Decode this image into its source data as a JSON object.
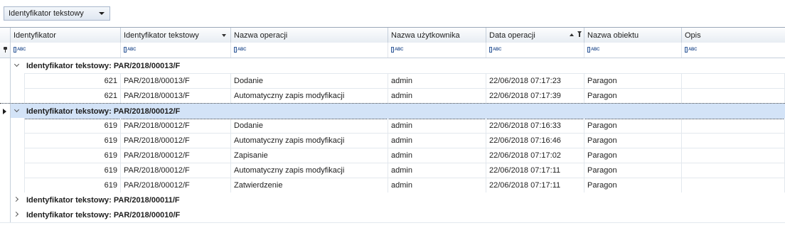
{
  "group_panel": {
    "label": "Identyfikator tekstowy"
  },
  "columns": [
    {
      "label": "Identyfikator"
    },
    {
      "label": "Identyfikator tekstowy"
    },
    {
      "label": "Nazwa operacji"
    },
    {
      "label": "Nazwa użytkownika"
    },
    {
      "label": "Data operacji"
    },
    {
      "label": "Nazwa obiektu"
    },
    {
      "label": "Opis"
    }
  ],
  "filter_icon_text": "ABC",
  "groups": [
    {
      "label": "Identyfikator tekstowy: PAR/2018/00013/F",
      "expanded": true,
      "rows": [
        {
          "id": "621",
          "text_id": "PAR/2018/00013/F",
          "operation": "Dodanie",
          "user": "admin",
          "date": "22/06/2018 07:17:23",
          "object": "Paragon",
          "desc": ""
        },
        {
          "id": "621",
          "text_id": "PAR/2018/00013/F",
          "operation": "Automatyczny zapis modyfikacji",
          "user": "admin",
          "date": "22/06/2018 07:17:39",
          "object": "Paragon",
          "desc": ""
        }
      ]
    },
    {
      "label": "Identyfikator tekstowy: PAR/2018/00012/F",
      "expanded": true,
      "selected": true,
      "rows": [
        {
          "id": "619",
          "text_id": "PAR/2018/00012/F",
          "operation": "Dodanie",
          "user": "admin",
          "date": "22/06/2018 07:16:33",
          "object": "Paragon",
          "desc": ""
        },
        {
          "id": "619",
          "text_id": "PAR/2018/00012/F",
          "operation": "Automatyczny zapis modyfikacji",
          "user": "admin",
          "date": "22/06/2018 07:16:46",
          "object": "Paragon",
          "desc": ""
        },
        {
          "id": "619",
          "text_id": "PAR/2018/00012/F",
          "operation": "Zapisanie",
          "user": "admin",
          "date": "22/06/2018 07:17:02",
          "object": "Paragon",
          "desc": ""
        },
        {
          "id": "619",
          "text_id": "PAR/2018/00012/F",
          "operation": "Automatyczny zapis modyfikacji",
          "user": "admin",
          "date": "22/06/2018 07:17:11",
          "object": "Paragon",
          "desc": ""
        },
        {
          "id": "619",
          "text_id": "PAR/2018/00012/F",
          "operation": "Zatwierdzenie",
          "user": "admin",
          "date": "22/06/2018 07:17:11",
          "object": "Paragon",
          "desc": ""
        }
      ]
    },
    {
      "label": "Identyfikator tekstowy: PAR/2018/00011/F",
      "expanded": false,
      "rows": []
    },
    {
      "label": "Identyfikator tekstowy: PAR/2018/00010/F",
      "expanded": false,
      "rows": []
    }
  ]
}
